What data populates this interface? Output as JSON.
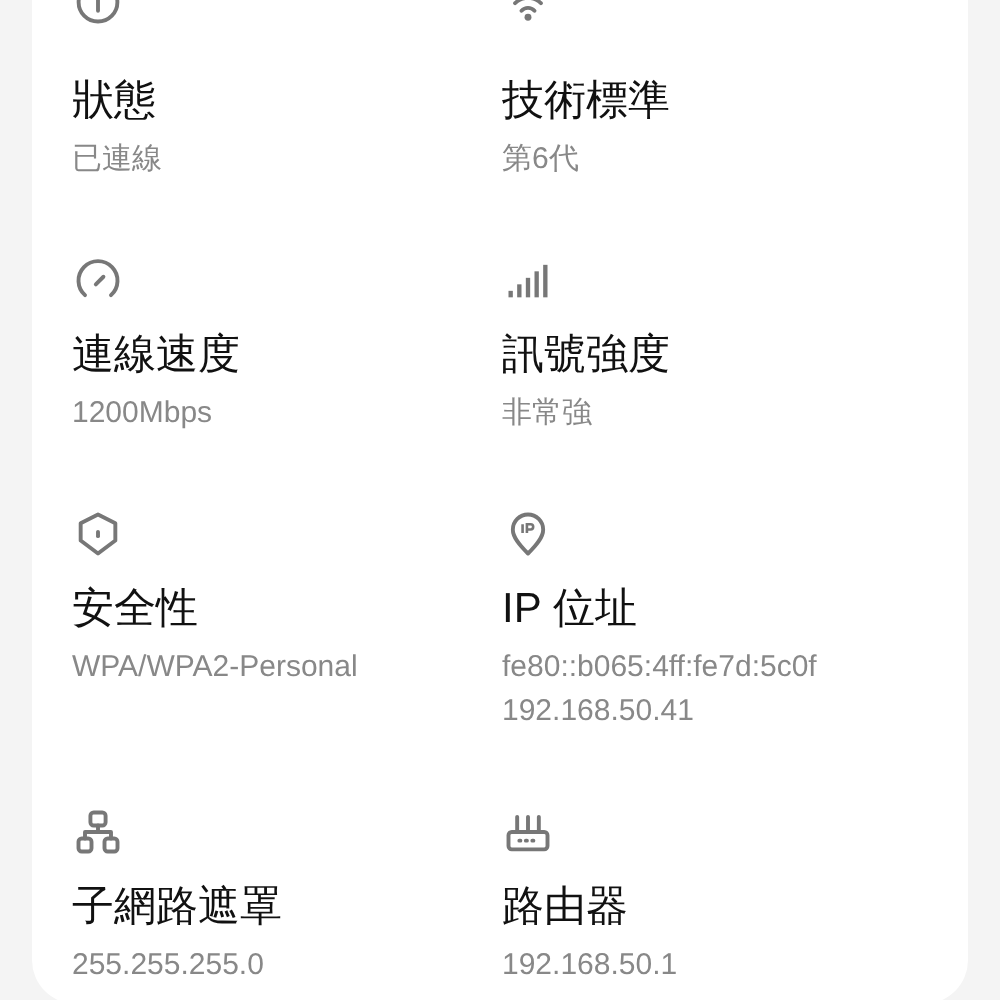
{
  "items": [
    {
      "title": "狀態",
      "values": [
        "已連線"
      ]
    },
    {
      "title": "技術標準",
      "values": [
        "第6代"
      ]
    },
    {
      "title": "連線速度",
      "values": [
        "1200Mbps"
      ]
    },
    {
      "title": "訊號強度",
      "values": [
        "非常強"
      ]
    },
    {
      "title": "安全性",
      "values": [
        "WPA/WPA2-Personal"
      ]
    },
    {
      "title": "IP 位址",
      "values": [
        "fe80::b065:4ff:fe7d:5c0f",
        "192.168.50.41"
      ]
    },
    {
      "title": "子網路遮罩",
      "values": [
        "255.255.255.0"
      ]
    },
    {
      "title": "路由器",
      "values": [
        "192.168.50.1"
      ]
    }
  ]
}
